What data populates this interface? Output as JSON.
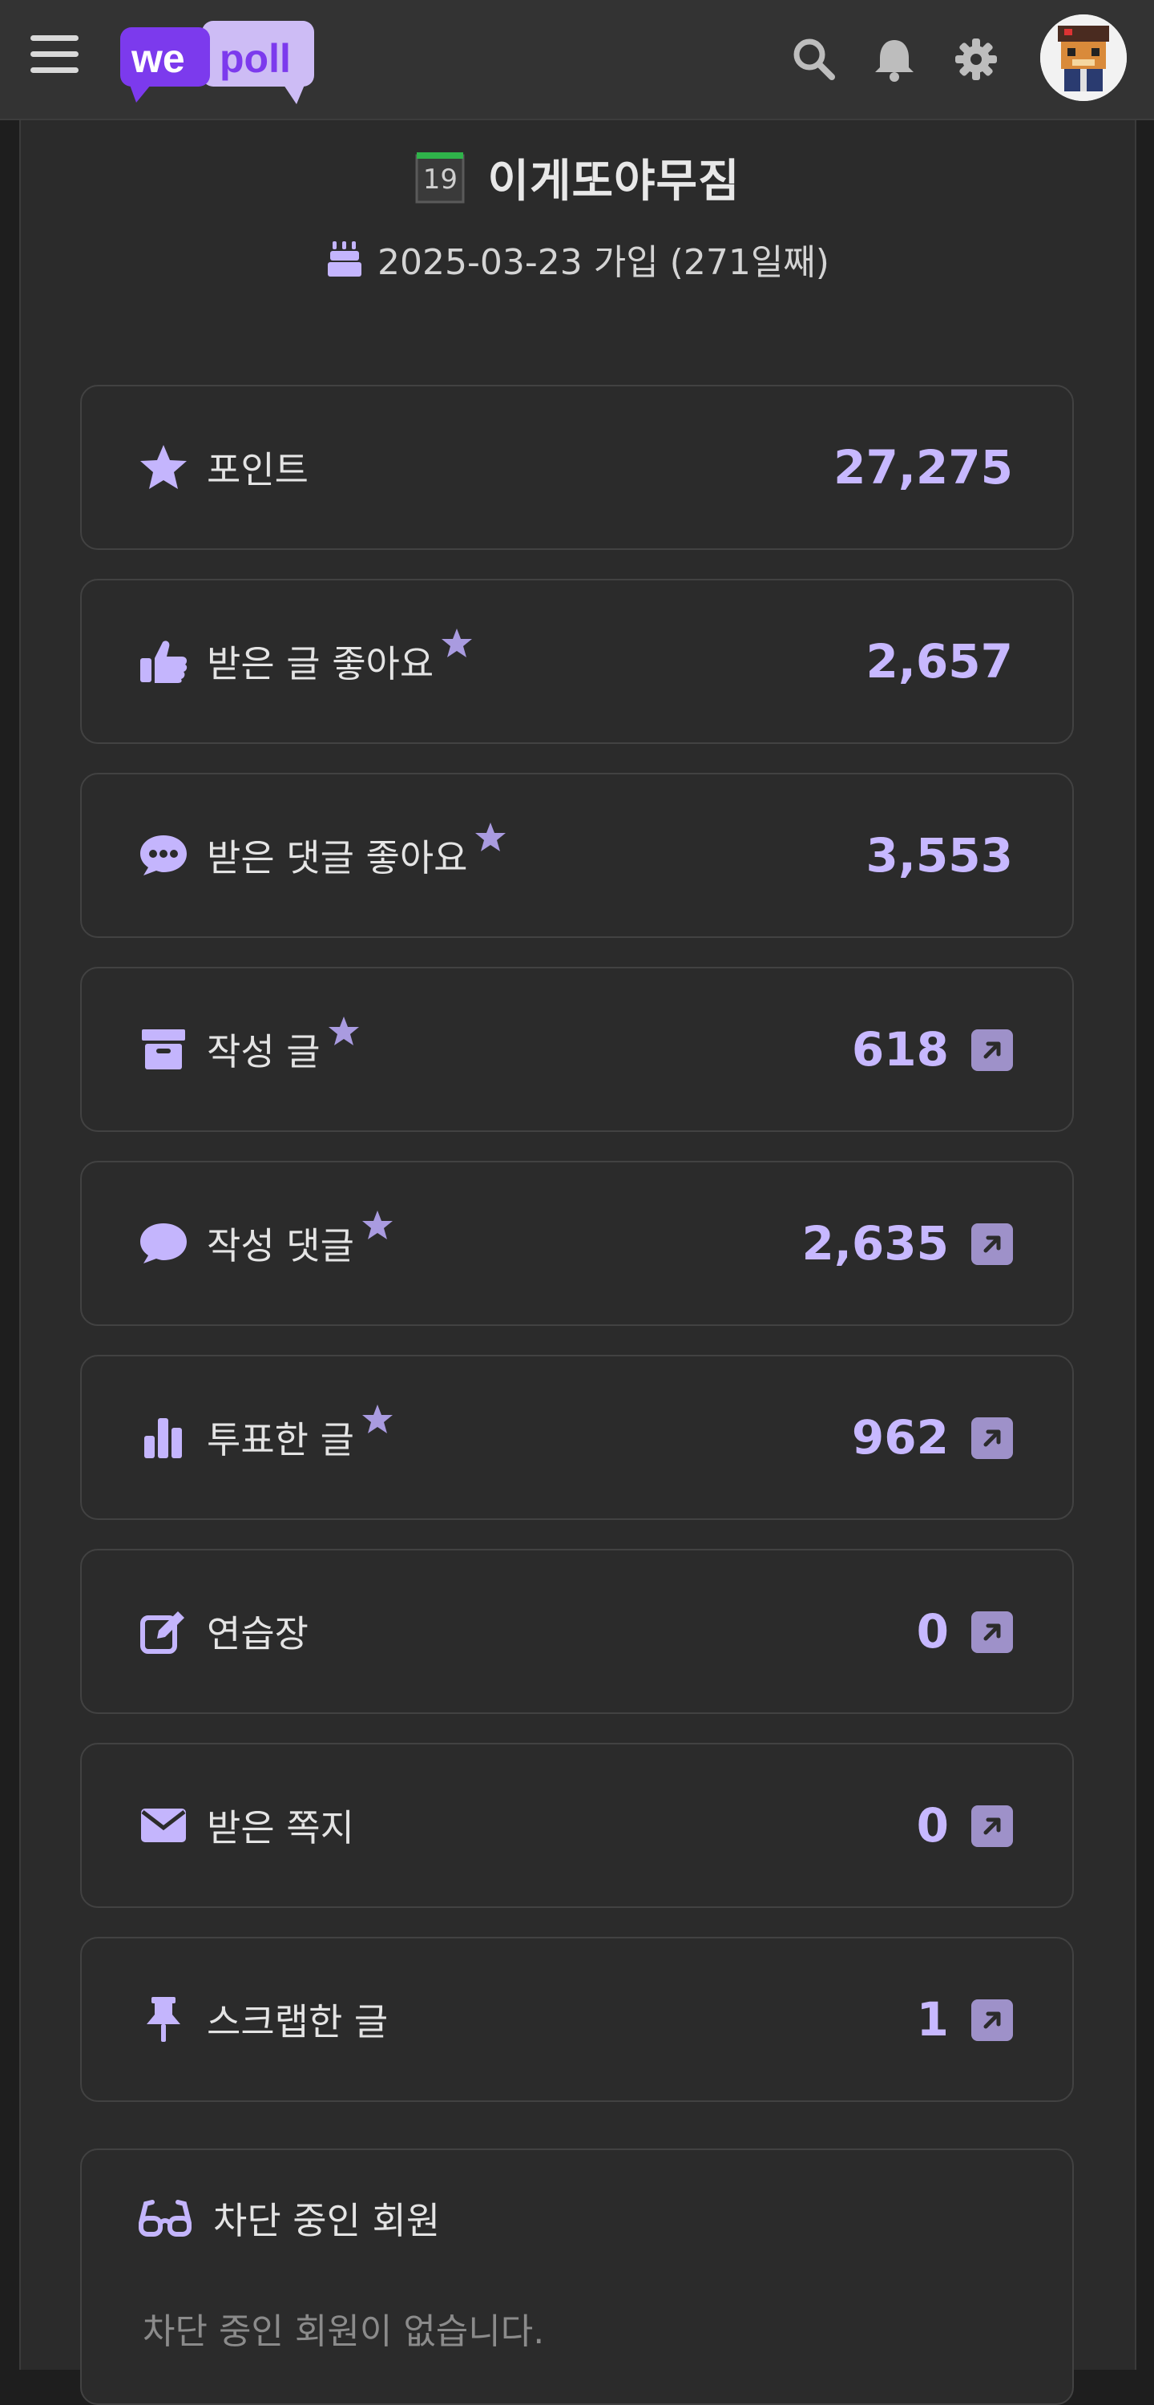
{
  "header": {
    "logo_left": "we",
    "logo_right": "poll",
    "icons": [
      "menu-icon",
      "search-icon",
      "bell-icon",
      "gear-icon",
      "avatar"
    ]
  },
  "profile": {
    "level_badge": "19",
    "username": "이게또야무짐",
    "join_text": "2025-03-23 가입 (271일째)"
  },
  "stats": [
    {
      "label": "포인트",
      "value": "27,275",
      "icon": "star-icon",
      "star": false,
      "link": false
    },
    {
      "label": "받은 글 좋아요",
      "value": "2,657",
      "icon": "thumbs-up-icon",
      "star": true,
      "link": false
    },
    {
      "label": "받은 댓글 좋아요",
      "value": "3,553",
      "icon": "comment-dots-icon",
      "star": true,
      "link": false
    },
    {
      "label": "작성 글",
      "value": "618",
      "icon": "archive-icon",
      "star": true,
      "link": true
    },
    {
      "label": "작성 댓글",
      "value": "2,635",
      "icon": "comment-icon",
      "star": true,
      "link": true
    },
    {
      "label": "투표한 글",
      "value": "962",
      "icon": "bar-chart-icon",
      "star": true,
      "link": true
    },
    {
      "label": "연습장",
      "value": "0",
      "icon": "edit-icon",
      "star": false,
      "link": true
    },
    {
      "label": "받은 쪽지",
      "value": "0",
      "icon": "envelope-icon",
      "star": false,
      "link": true
    },
    {
      "label": "스크랩한 글",
      "value": "1",
      "icon": "pin-icon",
      "star": false,
      "link": true
    }
  ],
  "blocked": {
    "title": "차단 중인 회원",
    "empty_text": "차단 중인 회원이 없습니다.",
    "icon": "glasses-icon"
  },
  "colors": {
    "accent": "#c7b8ff",
    "icon": "#c4b5fd",
    "link_button": "#9e91c9",
    "brand_purple": "#7c3aed",
    "background": "#2b2b2b"
  }
}
